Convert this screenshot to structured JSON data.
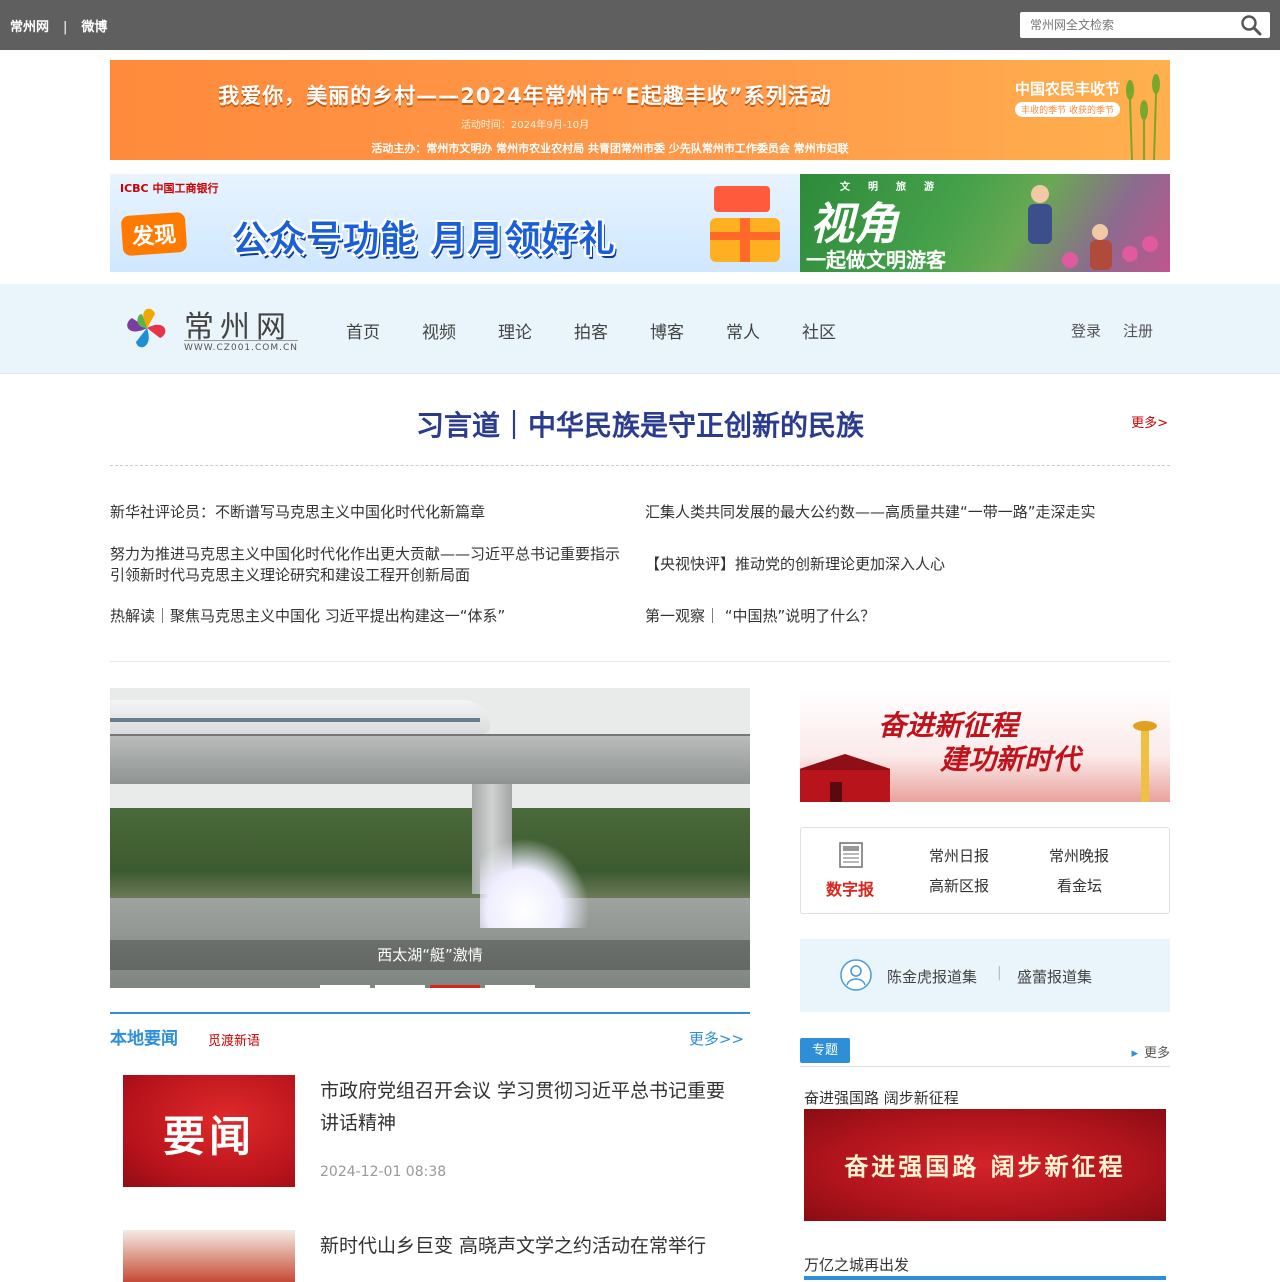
{
  "topbar": {
    "link1": "常州网",
    "sep": "|",
    "link2": "微博",
    "search_placeholder": "常州网全文检索"
  },
  "banner1": {
    "title": "我爱你，美丽的乡村——2024年常州市“E起趣丰收”系列活动",
    "time": "活动时间：2024年9月-10月",
    "organizers": "活动主办：常州市文明办  常州市农业农村局  共青团常州市委  少先队常州市工作委员会  常州市妇联",
    "logo": "中国农民丰收节",
    "logo_sub": "丰收的季节 收获的季节"
  },
  "banner2": {
    "bank": "ICBC 中国工商银行",
    "faxian": "发现",
    "slogan": "公众号功能 月月领好礼"
  },
  "banner3": {
    "tags": "文明旅游",
    "title": "视角",
    "sub": "一起做文明游客"
  },
  "nav": {
    "logo_name": "常州网",
    "logo_url": "WWW.CZ001.COM.CN",
    "items": [
      "首页",
      "视频",
      "理论",
      "拍客",
      "博客",
      "常人",
      "社区"
    ],
    "login": "登录",
    "register": "注册"
  },
  "headline": {
    "title": "习言道｜中华民族是守正创新的民族",
    "more": "更多>"
  },
  "news": [
    "新华社评论员：不断谱写马克思主义中国化时代化新篇章",
    "汇集人类共同发展的最大公约数——高质量共建“一带一路”走深走实",
    "努力为推进马克思主义中国化时代化作出更大贡献——习近平总书记重要指示引领新时代马克思主义理论研究和建设工程开创新局面",
    "【央视快评】推动党的创新理论更加深入人心",
    "热解读｜聚焦马克思主义中国化 习近平提出构建这一“体系”",
    "第一观察｜ “中国热”说明了什么？"
  ],
  "slider": {
    "caption": "西太湖“艇”激情",
    "active_index": 2,
    "count": 4
  },
  "local": {
    "title": "本地要闻",
    "subtitle": "觅渡新语",
    "more": "更多>>",
    "items": [
      {
        "thumb_text": "要闻",
        "title": "市政府党组召开会议 学习贯彻习近平总书记重要讲话精神",
        "date": "2024-12-01 08:38"
      },
      {
        "thumb_text": "",
        "title": "新时代山乡巨变 高晓声文学之约活动在常举行",
        "date": ""
      }
    ]
  },
  "promo": {
    "line1": "奋进新征程",
    "line2": "建功新时代"
  },
  "epaper": {
    "label": "数字报",
    "links": [
      "常州日报",
      "常州晚报",
      "高新区报",
      "看金坛"
    ]
  },
  "reports": {
    "r1": "陈金虎报道集",
    "sep": "|",
    "r2": "盛蕾报道集"
  },
  "special": {
    "tag": "专题",
    "more": "更多",
    "item1": "奋进强国路 阔步新征程",
    "item1_img": "奋进强国路 阔步新征程",
    "item2": "万亿之城再出发"
  }
}
